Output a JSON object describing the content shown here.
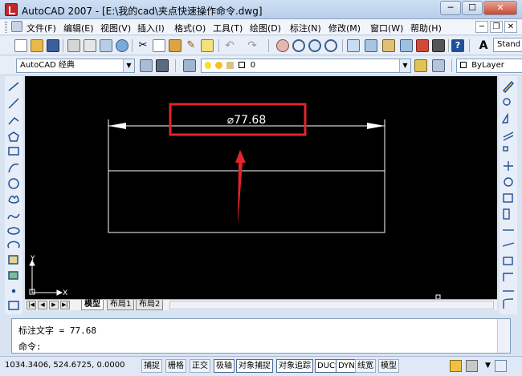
{
  "window": {
    "title": "AutoCAD 2007 - [E:\\我的cad\\夹点快速操作命令.dwg]"
  },
  "menu": [
    "文件(F)",
    "编辑(E)",
    "视图(V)",
    "插入(I)",
    "格式(O)",
    "工具(T)",
    "绘图(D)",
    "标注(N)",
    "修改(M)",
    "窗口(W)",
    "帮助(H)"
  ],
  "toolbar": {
    "text_style": "Stand"
  },
  "workspace": {
    "value": "AutoCAD 经典"
  },
  "layer": {
    "value": "0"
  },
  "color": {
    "value": "ByLayer"
  },
  "drawing": {
    "dimension_text": "⌀77.68",
    "ucs_y": "Y",
    "ucs_x": "X"
  },
  "layout_tabs": [
    "模型",
    "布局1",
    "布局2"
  ],
  "command": {
    "history": "标注文字 = 77.68",
    "prompt": "命令:"
  },
  "status": {
    "coords": "1034.3406, 524.6725, 0.0000",
    "buttons": [
      "捕捉",
      "栅格",
      "正交",
      "极轴",
      "对象捕捉",
      "对象追踪",
      "DUCS",
      "DYN",
      "线宽",
      "模型"
    ]
  },
  "colors": {
    "annotation": "#e0252b",
    "canvas": "#000000",
    "geometry": "#ffffff"
  }
}
